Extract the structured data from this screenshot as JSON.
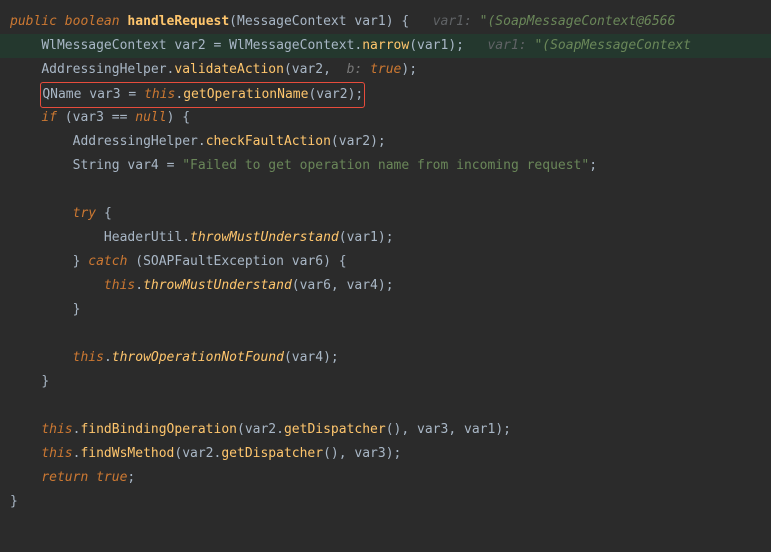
{
  "line1": {
    "kw_public": "public",
    "kw_boolean": "boolean",
    "method": "handleRequest",
    "paramType": "MessageContext",
    "paramName": "var1",
    "brace": "{",
    "hint_label": "var1:",
    "hint_val": "\"(SoapMessageContext@6566"
  },
  "line2": {
    "type": "WlMessageContext",
    "var": "var2",
    "eq": "=",
    "cls": "WlMessageContext",
    "method": "narrow",
    "arg": "var1",
    "hint_label": "var1:",
    "hint_val": "\"(SoapMessageContext"
  },
  "line3": {
    "cls": "AddressingHelper",
    "method": "validateAction",
    "arg1": "var2",
    "hint_b": "b:",
    "val_true": "true"
  },
  "line4": {
    "type": "QName",
    "var": "var3",
    "eq": "=",
    "this": "this",
    "method": "getOperationName",
    "arg": "var2"
  },
  "line5": {
    "kw_if": "if",
    "var": "var3",
    "op": "==",
    "null": "null",
    "brace": "{"
  },
  "line6": {
    "cls": "AddressingHelper",
    "method": "checkFaultAction",
    "arg": "var2"
  },
  "line7": {
    "type": "String",
    "var": "var4",
    "eq": "=",
    "str": "\"Failed to get operation name from incoming request\""
  },
  "line8": {
    "kw_try": "try",
    "brace": "{"
  },
  "line9": {
    "cls": "HeaderUtil",
    "method": "throwMustUnderstand",
    "arg": "var1"
  },
  "line10": {
    "brace_close": "}",
    "kw_catch": "catch",
    "type": "SOAPFaultException",
    "var": "var6",
    "brace": "{"
  },
  "line11": {
    "this": "this",
    "method": "throwMustUnderstand",
    "arg1": "var6",
    "arg2": "var4"
  },
  "line12": {
    "brace": "}"
  },
  "line13": {
    "this": "this",
    "method": "throwOperationNotFound",
    "arg": "var4"
  },
  "line14": {
    "brace": "}"
  },
  "line15": {
    "this": "this",
    "method": "findBindingOperation",
    "arg1": "var2",
    "method2": "getDispatcher",
    "arg2": "var3",
    "arg3": "var1"
  },
  "line16": {
    "this": "this",
    "method": "findWsMethod",
    "arg1": "var2",
    "method2": "getDispatcher",
    "arg2": "var3"
  },
  "line17": {
    "kw_return": "return",
    "true": "true"
  },
  "line18": {
    "brace": "}"
  }
}
